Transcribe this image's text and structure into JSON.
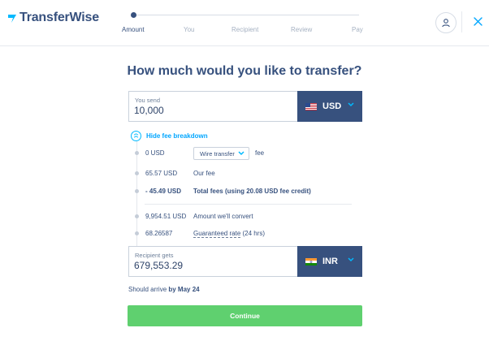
{
  "brand": {
    "name": "TransferWise"
  },
  "stepper": {
    "steps": [
      "Amount",
      "You",
      "Recipient",
      "Review",
      "Pay"
    ],
    "current_step": 1
  },
  "page": {
    "title": "How much would you like to transfer?"
  },
  "send": {
    "label": "You send",
    "value": "10,000",
    "currency": "USD",
    "flag_icon": "us-flag-icon"
  },
  "fees": {
    "toggle_label": "Hide fee breakdown",
    "rows": [
      {
        "amount": "0 USD",
        "method": "Wire transfer",
        "suffix": "fee"
      },
      {
        "amount": "65.57 USD",
        "description": "Our fee"
      },
      {
        "amount": "- 45.49 USD",
        "description": "Total fees (using 20.08 USD fee credit)"
      },
      {
        "amount": "9,954.51 USD",
        "description": "Amount we'll convert"
      },
      {
        "amount": "68.26587",
        "description_link": "Guaranteed rate",
        "description_suffix": "(24 hrs)"
      }
    ]
  },
  "receive": {
    "label": "Recipient gets",
    "value": "679,553.29",
    "currency": "INR",
    "flag_icon": "india-flag-icon"
  },
  "arrival": {
    "prefix": "Should arrive",
    "date": "by May 24"
  },
  "actions": {
    "continue_label": "Continue"
  },
  "colors": {
    "navy": "#37517e",
    "accent_blue": "#00a6ff",
    "continue_green": "#5fd06f",
    "border": "#c9d1dc"
  }
}
